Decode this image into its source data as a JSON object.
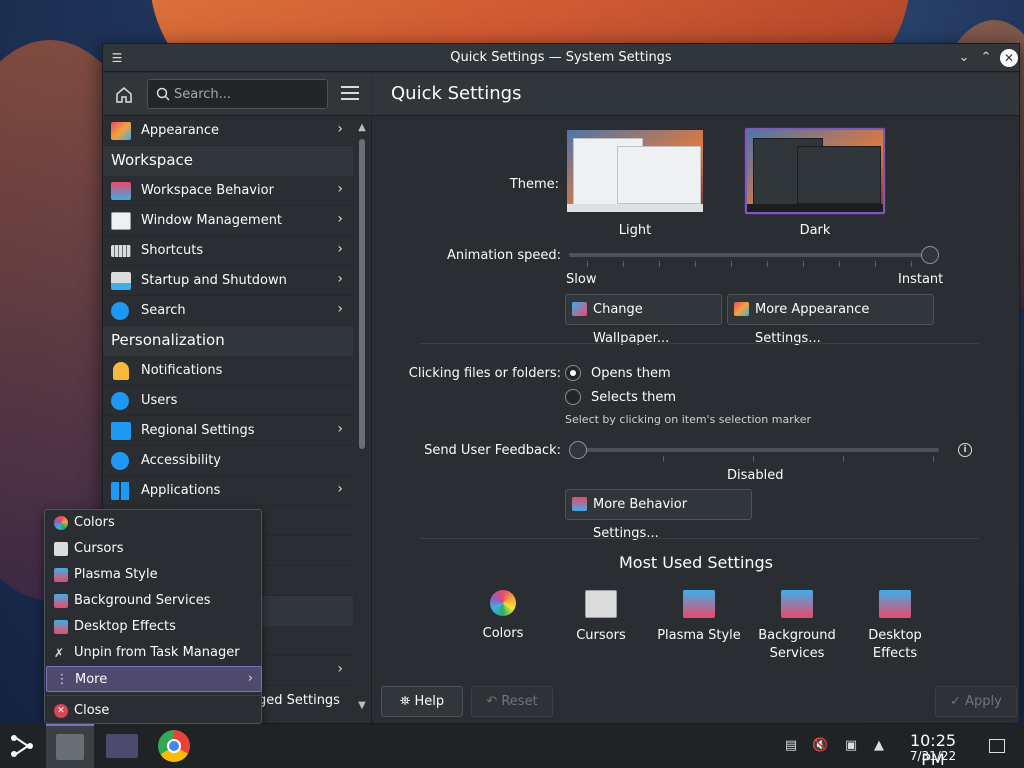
{
  "window": {
    "title": "Quick Settings — System Settings"
  },
  "sidebar": {
    "search_placeholder": "Search...",
    "items": [
      {
        "label": "Appearance",
        "icon": "appearance-icon",
        "chevron": true
      },
      {
        "section": "Workspace"
      },
      {
        "label": "Workspace Behavior",
        "icon": "workspace-behavior-icon",
        "chevron": true
      },
      {
        "label": "Window Management",
        "icon": "window-management-icon",
        "chevron": true
      },
      {
        "label": "Shortcuts",
        "icon": "keyboard-icon",
        "chevron": true
      },
      {
        "label": "Startup and Shutdown",
        "icon": "startup-icon",
        "chevron": true
      },
      {
        "label": "Search",
        "icon": "search-icon",
        "chevron": true
      },
      {
        "section": "Personalization"
      },
      {
        "label": "Notifications",
        "icon": "bell-icon",
        "chevron": false
      },
      {
        "label": "Users",
        "icon": "users-icon",
        "chevron": false
      },
      {
        "label": "Regional Settings",
        "icon": "regional-icon",
        "chevron": true
      },
      {
        "label": "Accessibility",
        "icon": "accessibility-icon",
        "chevron": false
      },
      {
        "label": "Applications",
        "icon": "applications-icon",
        "chevron": true
      }
    ],
    "footer_partial": "ged Settings"
  },
  "main": {
    "page_title": "Quick Settings",
    "theme_label": "Theme:",
    "themes": [
      {
        "name": "Light",
        "selected": false
      },
      {
        "name": "Dark",
        "selected": true
      }
    ],
    "animation_label": "Animation speed:",
    "animation_slow": "Slow",
    "animation_instant": "Instant",
    "animation_value": 1.0,
    "change_wallpaper": "Change Wallpaper...",
    "more_appearance": "More Appearance Settings...",
    "clicking_label": "Clicking files or folders:",
    "opens_them": "Opens them",
    "selects_them": "Selects them",
    "selection_hint": "Select by clicking on item's selection marker",
    "clicking_selected": "Opens them",
    "feedback_label": "Send User Feedback:",
    "feedback_value": "Disabled",
    "feedback_level": 0,
    "more_behavior": "More Behavior Settings...",
    "most_used_title": "Most Used Settings",
    "most_used": [
      {
        "label": "Colors",
        "icon": "colors-icon"
      },
      {
        "label": "Cursors",
        "icon": "cursors-icon"
      },
      {
        "label": "Plasma Style",
        "icon": "plasma-style-icon"
      },
      {
        "label": "Background\nServices",
        "icon": "background-services-icon"
      },
      {
        "label": "Desktop\nEffects",
        "icon": "desktop-effects-icon"
      }
    ],
    "help": "Help",
    "reset": "Reset",
    "apply": "Apply"
  },
  "context_menu": {
    "items": [
      {
        "label": "Colors",
        "icon": "colors-icon"
      },
      {
        "label": "Cursors",
        "icon": "cursors-icon"
      },
      {
        "label": "Plasma Style",
        "icon": "plasma-style-icon"
      },
      {
        "label": "Background Services",
        "icon": "background-services-icon"
      },
      {
        "label": "Desktop Effects",
        "icon": "desktop-effects-icon"
      },
      {
        "label": "Unpin from Task Manager",
        "icon": "unpin-icon"
      },
      {
        "label": "More",
        "icon": "more-icon",
        "highlighted": true
      },
      {
        "label": "Close",
        "icon": "close-icon"
      }
    ]
  },
  "taskbar": {
    "time": "10:25 PM",
    "date": "7/31/22"
  },
  "colors": {
    "accent": "#7b6fc2",
    "window_bg": "#2a2e32",
    "header_bg": "#31363b"
  }
}
